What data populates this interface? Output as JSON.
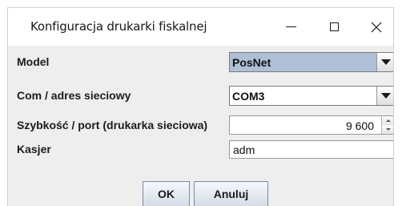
{
  "window": {
    "title": "Konfiguracja drukarki fiskalnej",
    "minimize_icon": "minimize-icon",
    "maximize_icon": "maximize-icon",
    "close_icon": "close-icon",
    "close_glyph": "✕"
  },
  "form": {
    "model": {
      "label": "Model",
      "value": "PosNet"
    },
    "port": {
      "label": "Com / adres sieciowy",
      "value": "COM3"
    },
    "speed": {
      "label": "Szybkość / port (drukarka sieciowa)",
      "value": "9 600"
    },
    "cashier": {
      "label": "Kasjer",
      "value": "adm"
    }
  },
  "buttons": {
    "ok_label": "OK",
    "cancel_label": "Anuluj"
  },
  "colors": {
    "selected_combo": "#aebfd6",
    "dialog_background": "#eeeeee"
  }
}
